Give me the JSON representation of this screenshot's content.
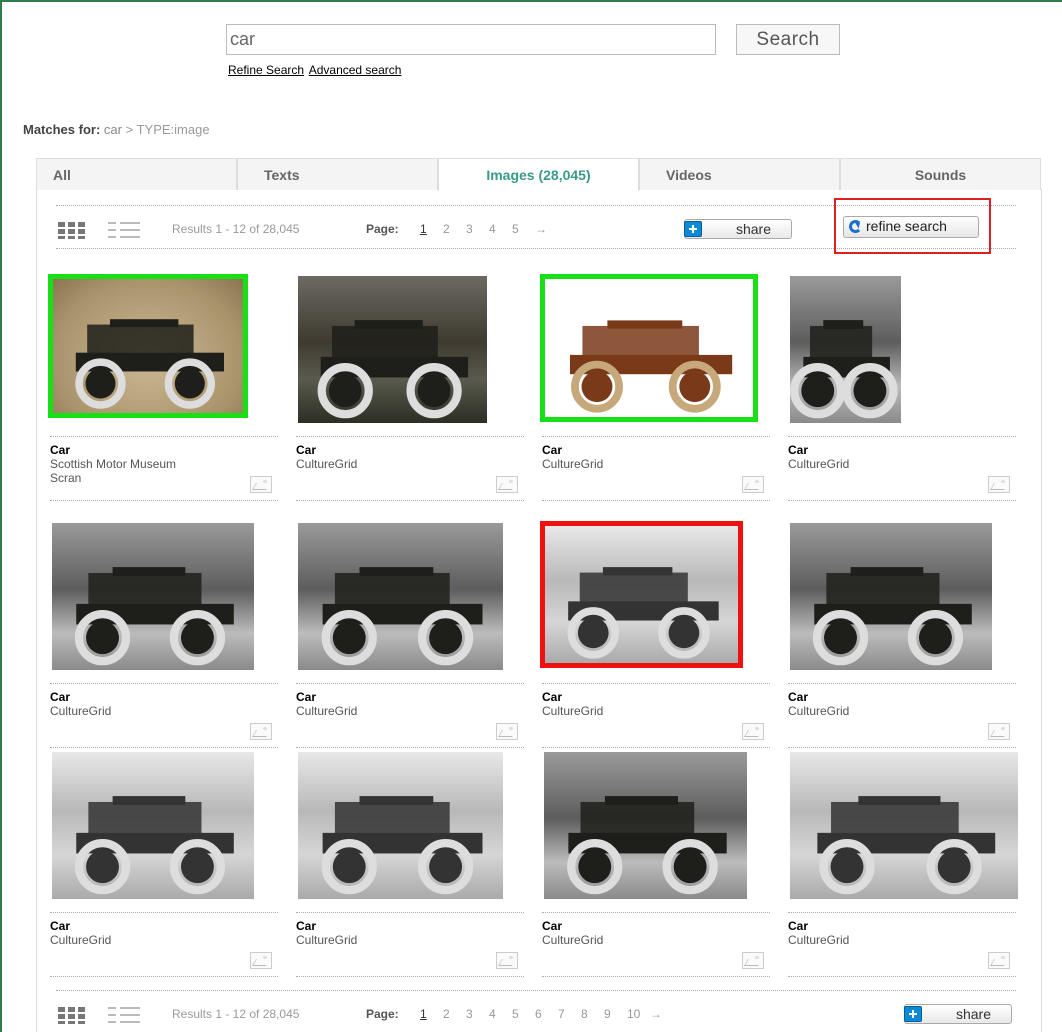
{
  "search": {
    "query": "car",
    "button_label": "Search",
    "refine_link": "Refine Search",
    "advanced_link": "Advanced search"
  },
  "matches": {
    "label": "Matches for:",
    "query": "car",
    "filter": "> TYPE:image"
  },
  "tabs": [
    {
      "label": "All",
      "active": false
    },
    {
      "label": "Texts",
      "active": false
    },
    {
      "label": "Images (28,045)",
      "active": true
    },
    {
      "label": "Videos",
      "active": false
    },
    {
      "label": "Sounds",
      "active": false
    }
  ],
  "toolbar_top": {
    "results": "Results 1 - 12 of 28,045",
    "page_label": "Page:",
    "pages": [
      "1",
      "2",
      "3",
      "4",
      "5",
      "→"
    ],
    "share_label": "share",
    "refine_label": "refine search"
  },
  "toolbar_bottom": {
    "results": "Results 1 - 12 of 28,045",
    "page_label": "Page:",
    "pages": [
      "1",
      "2",
      "3",
      "4",
      "5",
      "6",
      "7",
      "8",
      "9",
      "10",
      "→"
    ],
    "share_label": "share"
  },
  "results": [
    {
      "title": "Car",
      "source": "Scottish Motor Museum",
      "source2": "Scran",
      "highlight": "green",
      "tone": "sepia"
    },
    {
      "title": "Car",
      "source": "CultureGrid",
      "source2": "",
      "highlight": "none",
      "tone": "dark"
    },
    {
      "title": "Car",
      "source": "CultureGrid",
      "source2": "",
      "highlight": "green",
      "tone": "white"
    },
    {
      "title": "Car",
      "source": "CultureGrid",
      "source2": "",
      "highlight": "none",
      "tone": "gray"
    },
    {
      "title": "Car",
      "source": "CultureGrid",
      "source2": "",
      "highlight": "none",
      "tone": "gray"
    },
    {
      "title": "Car",
      "source": "CultureGrid",
      "source2": "",
      "highlight": "none",
      "tone": "gray"
    },
    {
      "title": "Car",
      "source": "CultureGrid",
      "source2": "",
      "highlight": "red",
      "tone": "light"
    },
    {
      "title": "Car",
      "source": "CultureGrid",
      "source2": "",
      "highlight": "none",
      "tone": "gray"
    },
    {
      "title": "Car",
      "source": "CultureGrid",
      "source2": "",
      "highlight": "none",
      "tone": "light"
    },
    {
      "title": "Car",
      "source": "CultureGrid",
      "source2": "",
      "highlight": "none",
      "tone": "light"
    },
    {
      "title": "Car",
      "source": "CultureGrid",
      "source2": "",
      "highlight": "none",
      "tone": "gray"
    },
    {
      "title": "Car",
      "source": "CultureGrid",
      "source2": "",
      "highlight": "none",
      "tone": "light"
    }
  ],
  "colors": {
    "frame": "#2e7d4f",
    "active_tab": "#3a9a8a",
    "highlight_green": "#17e017",
    "highlight_red": "#ef1010",
    "share_icon": "#0b8ad6",
    "refresh_icon": "#1c6fd0"
  }
}
